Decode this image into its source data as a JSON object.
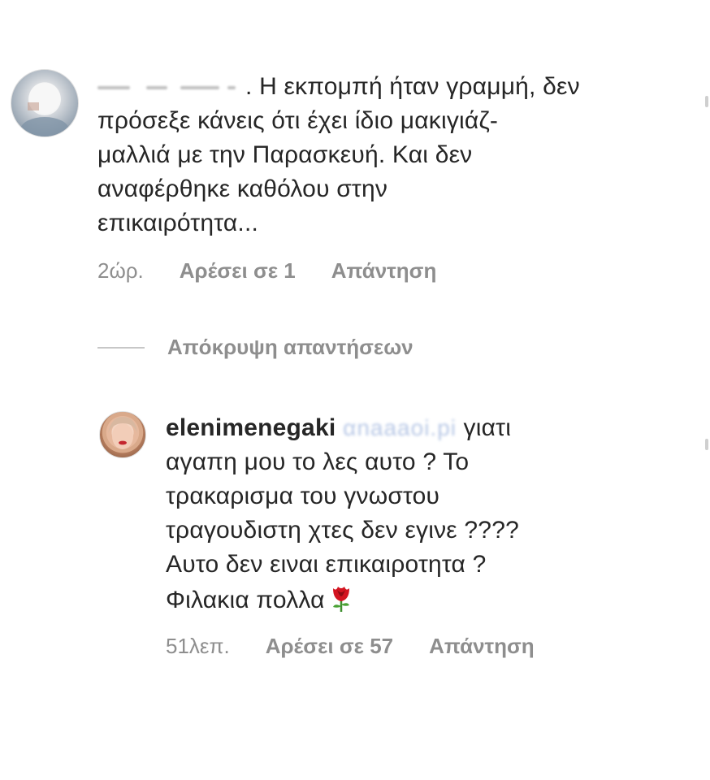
{
  "comments": [
    {
      "text": ". Η εκπομπή ήταν γραμμή, δεν\nπρόσεξε κάνεις ότι έχει ίδιο μακιγιάζ-\nμαλλιά με την Παρασκευή. Και δεν\nαναφέρθηκε καθόλου στην\nεπικαιρότητα...",
      "time": "2ώρ.",
      "likes": "Αρέσει σε 1",
      "reply": "Απάντηση"
    },
    {
      "username": "elenimenegaki",
      "mention": " αnaaaoi.pi",
      "text": " γιατι\nαγαπη μου το λες αυτο ? Το\nτρακαρισμα του γνωστου\nτραγουδιστη χτες δεν εγινε ????\nΑυτο δεν ειναι επικαιροτητα ?\nΦιλακια πολλα",
      "time": "51λεπ.",
      "likes": "Αρέσει σε 57",
      "reply": "Απάντηση"
    }
  ],
  "hide_replies": "Απόκρυψη απαντήσεων",
  "icons": {
    "rose": "rose-emoji-icon"
  },
  "colors": {
    "text": "#262626",
    "meta": "#8e8e8e",
    "divider": "#c7c7c7"
  }
}
